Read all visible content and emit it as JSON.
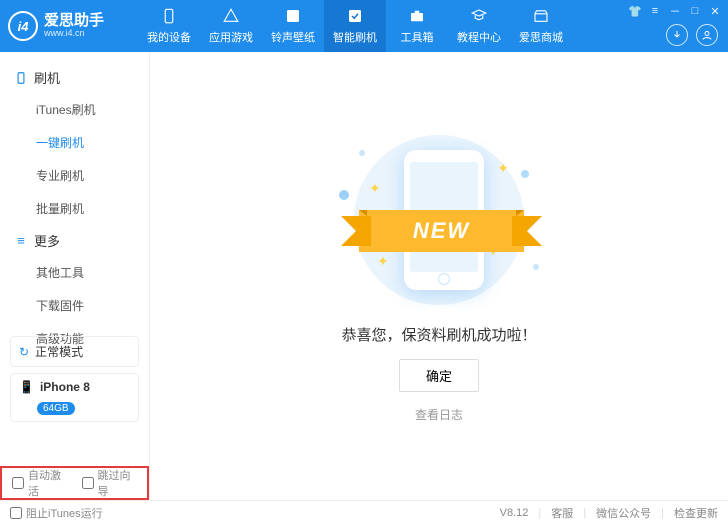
{
  "logo": {
    "badge": "i4",
    "title": "爱思助手",
    "sub": "www.i4.cn"
  },
  "tabs": [
    {
      "label": "我的设备"
    },
    {
      "label": "应用游戏"
    },
    {
      "label": "铃声壁纸"
    },
    {
      "label": "智能刷机"
    },
    {
      "label": "工具箱"
    },
    {
      "label": "教程中心"
    },
    {
      "label": "爱思商城"
    }
  ],
  "sidebar": {
    "group1": "刷机",
    "items1": [
      "iTunes刷机",
      "一键刷机",
      "专业刷机",
      "批量刷机"
    ],
    "group2": "更多",
    "items2": [
      "其他工具",
      "下载固件",
      "高级功能"
    ],
    "mode": "正常模式",
    "device": "iPhone 8",
    "storage": "64GB",
    "auto_activate": "自动激活",
    "skip_guide": "跳过向导"
  },
  "main": {
    "ribbon": "NEW",
    "success": "恭喜您，保资料刷机成功啦！",
    "ok": "确定",
    "log": "查看日志"
  },
  "footer": {
    "block_itunes": "阻止iTunes运行",
    "version": "V8.12",
    "cs": "客服",
    "wechat": "微信公众号",
    "update": "检查更新"
  }
}
